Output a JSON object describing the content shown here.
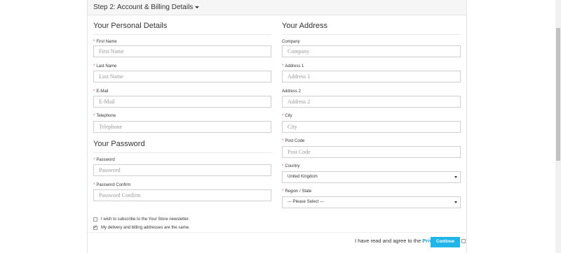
{
  "header": {
    "title": "Step 2: Account & Billing Details"
  },
  "personal": {
    "title": "Your Personal Details",
    "fields": [
      {
        "label": "First Name",
        "placeholder": "First Name",
        "required": true
      },
      {
        "label": "Last Name",
        "placeholder": "Last Name",
        "required": true
      },
      {
        "label": "E-Mail",
        "placeholder": "E-Mail",
        "required": true
      },
      {
        "label": "Telephone",
        "placeholder": "Telephone",
        "required": true
      }
    ]
  },
  "password": {
    "title": "Your Password",
    "fields": [
      {
        "label": "Password",
        "placeholder": "Password",
        "required": true
      },
      {
        "label": "Password Confirm",
        "placeholder": "Password Confirm",
        "required": true
      }
    ]
  },
  "address": {
    "title": "Your Address",
    "fields": [
      {
        "label": "Company",
        "placeholder": "Company",
        "required": false
      },
      {
        "label": "Address 1",
        "placeholder": "Address 1",
        "required": true
      },
      {
        "label": "Address 2",
        "placeholder": "Address 2",
        "required": false
      },
      {
        "label": "City",
        "placeholder": "City",
        "required": true
      },
      {
        "label": "Post Code",
        "placeholder": "Post Code",
        "required": true
      }
    ],
    "country": {
      "label": "Country",
      "selected": "United Kingdom",
      "required": true
    },
    "region": {
      "label": "Region / State",
      "selected": "--- Please Select ---",
      "required": true
    }
  },
  "options": {
    "newsletter": {
      "label": "I wish to subscribe to the Your Store newsletter.",
      "checked": false
    },
    "same_address": {
      "label": "My delivery and billing addresses are the same.",
      "checked": true
    }
  },
  "agree": {
    "text": "I have read and agree to the",
    "link": "Privacy Policy",
    "checked": false
  },
  "continue_label": "Continue",
  "required_mark": "*"
}
